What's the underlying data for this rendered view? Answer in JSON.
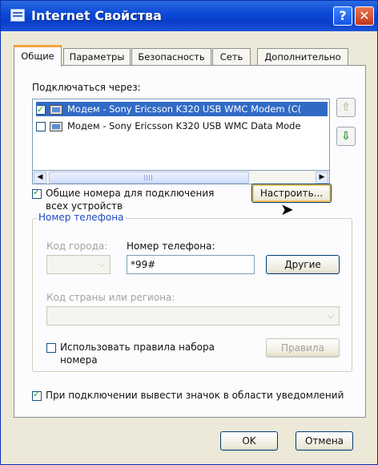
{
  "window": {
    "title": "Internet Свойства"
  },
  "tabs": [
    {
      "label": "Общие"
    },
    {
      "label": "Параметры"
    },
    {
      "label": "Безопасность"
    },
    {
      "label": "Сеть"
    },
    {
      "label": "Дополнительно"
    }
  ],
  "connect_via": {
    "label": "Подключаться через:",
    "devices": [
      {
        "label": "Модем - Sony Ericsson K320 USB WMC Modem (C(",
        "checked": true,
        "selected": true
      },
      {
        "label": "Модем - Sony Ericsson K320 USB WMC Data Mode",
        "checked": false,
        "selected": false
      }
    ]
  },
  "shared_numbers": {
    "label_line1": "Общие номера для подключения",
    "label_line2": "всех устройств",
    "configure_button": "Настроить..."
  },
  "phone": {
    "group_title": "Номер телефона",
    "area_code_label": "Код города:",
    "number_label": "Номер телефона:",
    "number_value": "*99#",
    "other_button": "Другие",
    "country_label": "Код страны или региона:",
    "dialing_rules_line1": "Использовать правила набора",
    "dialing_rules_line2": "номера",
    "rules_button": "Правила"
  },
  "notify": {
    "label": "При подключении вывести значок в области уведомлений"
  },
  "footer": {
    "ok": "OK",
    "cancel": "Отмена"
  }
}
